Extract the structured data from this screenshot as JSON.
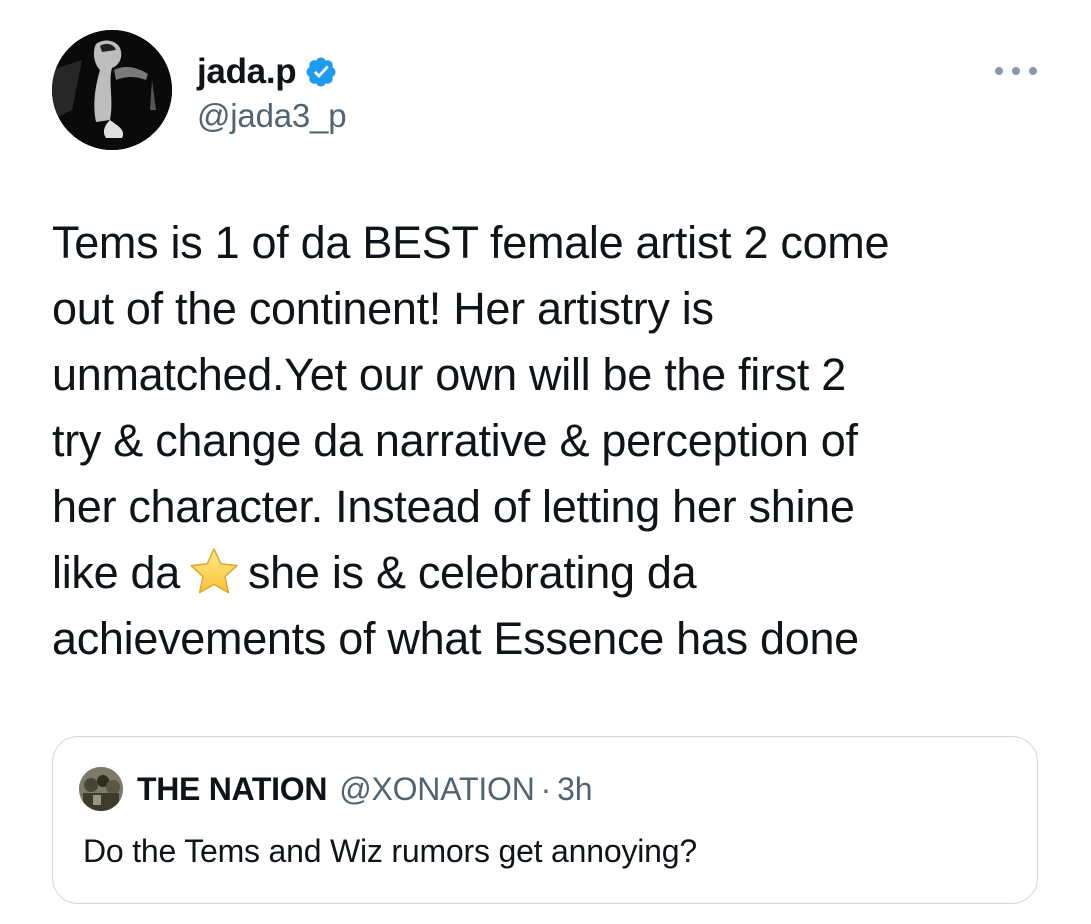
{
  "tweet": {
    "author": {
      "display_name": "jada.p",
      "handle": "@jada3_p",
      "verified": true,
      "avatar_icon": "profile-photo"
    },
    "more_icon": "more-horizontal-icon",
    "body_lines": [
      "Tems is 1 of da BEST female artist 2 come",
      "out of the continent! Her artistry is",
      "unmatched.Yet our own will be the first 2",
      "try & change da narrative & perception of",
      "her character. Instead of letting her shine"
    ],
    "body_line6_before": "like da",
    "body_emoji": "star",
    "body_line6_after": "she is & celebrating da",
    "body_line7": "achievements of what Essence has done"
  },
  "quote": {
    "display_name": "THE NATION",
    "handle": "@XONATION",
    "separator": "·",
    "time": "3h",
    "text": "Do the Tems and Wiz rumors get annoying?"
  },
  "colors": {
    "text": "#0f1419",
    "secondary": "#536471",
    "verified_blue": "#1d9bf0",
    "border": "#cfd9de"
  }
}
